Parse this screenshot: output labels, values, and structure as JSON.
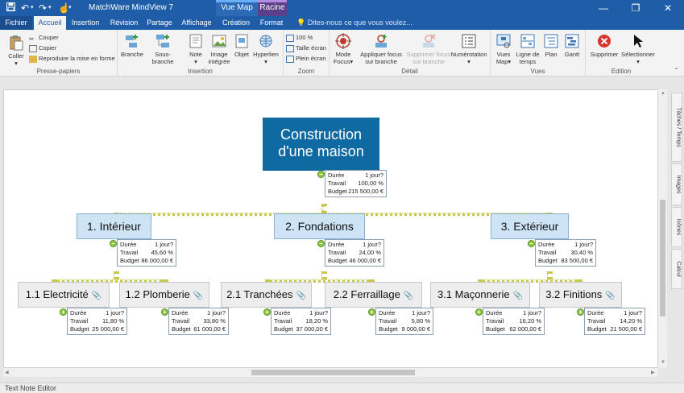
{
  "window": {
    "title": "MatchWare MindView 7",
    "context_group": "Vue Map",
    "context_group2": "Racine",
    "controls": [
      "—",
      "❐",
      "✕"
    ]
  },
  "tabs": {
    "items": [
      "Fichier",
      "Accueil",
      "Insertion",
      "Révision",
      "Partage",
      "Affichage",
      "Création",
      "Format"
    ],
    "active": "Accueil",
    "tell_me": "Dites-nous ce que vous voulez..."
  },
  "ribbon": {
    "presse_papiers": {
      "label": "Presse-papiers",
      "coller": "Coller",
      "couper": "Couper",
      "copier": "Copier",
      "reproduire": "Reproduire la mise en forme"
    },
    "insertion": {
      "label": "Insertion",
      "branche": "Branche",
      "sous_branche": "Sous-branche",
      "note": "Note",
      "image_integree": [
        "Image",
        "intégrée"
      ],
      "objet": "Objet",
      "hyperlien": "Hyperlien"
    },
    "zoom": {
      "label": "Zoom",
      "z100": "100 %",
      "taille_ecran": "Taille écran",
      "plein_ecran": "Plein écran"
    },
    "detail": {
      "label": "Détail",
      "mode_focus": [
        "Mode",
        "Focus"
      ],
      "appliquer_focus": [
        "Appliquer focus",
        "sur branche"
      ],
      "supprimer_focus": [
        "Supprimer focus",
        "sur branche"
      ],
      "numerotation": "Numérotation"
    },
    "vues": {
      "label": "Vues",
      "vues_map": [
        "Vues",
        "Map"
      ],
      "ligne_temps": [
        "Ligne de",
        "temps"
      ],
      "plan": "Plan",
      "gantt": "Gantt"
    },
    "edition": {
      "label": "Edition",
      "supprimer": "Supprimer",
      "selectionner": "Sélectionner"
    }
  },
  "side_tabs": [
    "Tâches / Temps",
    "Images",
    "Icônes",
    "Calcul"
  ],
  "bottom_panel": "Text Note Editor",
  "info_labels": {
    "duree": "Durée",
    "travail": "Travail",
    "budget": "Budget"
  },
  "mindmap": {
    "root": {
      "title": [
        "Construction",
        "d'une maison"
      ],
      "duree": "1 jour?",
      "travail": "100,00 %",
      "budget": "215 500,00 €"
    },
    "branches": [
      {
        "title": "1.  Intérieur",
        "duree": "1 jour?",
        "travail": "45,60 %",
        "budget": "86 000,00 €",
        "children": [
          {
            "title": "1.1  Electricité",
            "duree": "1 jour?",
            "travail": "11,80 %",
            "budget": "25 000,00 €"
          },
          {
            "title": "1.2  Plomberie",
            "duree": "1 jour?",
            "travail": "33,80 %",
            "budget": "61 000,00 €"
          }
        ]
      },
      {
        "title": "2.  Fondations",
        "duree": "1 jour?",
        "travail": "24,00 %",
        "budget": "46 000,00 €",
        "children": [
          {
            "title": "2.1  Tranchées",
            "duree": "1 jour?",
            "travail": "18,20 %",
            "budget": "37 000,00 €"
          },
          {
            "title": "2.2  Ferraillage",
            "duree": "1 jour?",
            "travail": "5,80 %",
            "budget": "9 000,00 €"
          }
        ]
      },
      {
        "title": "3.  Extérieur",
        "duree": "1 jour?",
        "travail": "30,40 %",
        "budget": "83 500,00 €",
        "children": [
          {
            "title": "3.1  Maçonnerie",
            "duree": "1 jour?",
            "travail": "16,20 %",
            "budget": "62 000,00 €"
          },
          {
            "title": "3.2  Finitions",
            "duree": "1 jour?",
            "travail": "14,20 %",
            "budget": "21 500,00 €"
          }
        ]
      }
    ]
  }
}
